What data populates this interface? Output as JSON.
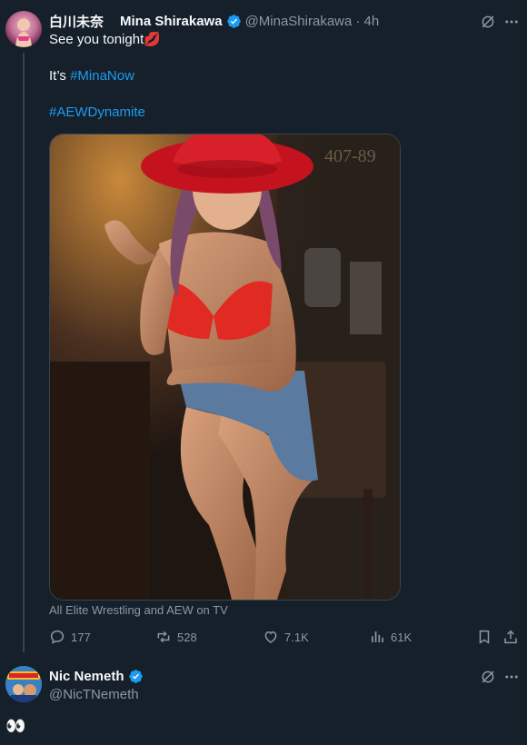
{
  "tweet": {
    "display_name_jp": "白川未奈",
    "display_name": "Mina Shirakawa",
    "handle": "@MinaShirakawa",
    "time": "· 4h",
    "line1": "See you tonight",
    "line1_emoji": "💋",
    "line2_prefix": "It’s ",
    "hashtag1": "#MinaNow",
    "hashtag2": "#AEWDynamite",
    "media_caption": "All Elite Wrestling and AEW on TV",
    "image_text": "407-89",
    "actions": {
      "replies": "177",
      "reposts": "528",
      "likes": "7.1K",
      "views": "61K"
    }
  },
  "reply": {
    "display_name": "Nic Nemeth",
    "handle": "@NicTNemeth",
    "text": "👀"
  },
  "colors": {
    "background": "#15202b",
    "accent": "#1d9bf0",
    "muted": "#8b98a5",
    "text": "#f7f9f9"
  },
  "icons": [
    "grok-icon",
    "more-icon",
    "reply-icon",
    "repost-icon",
    "like-icon",
    "views-icon",
    "bookmark-icon",
    "share-icon",
    "verified-badge-icon"
  ]
}
